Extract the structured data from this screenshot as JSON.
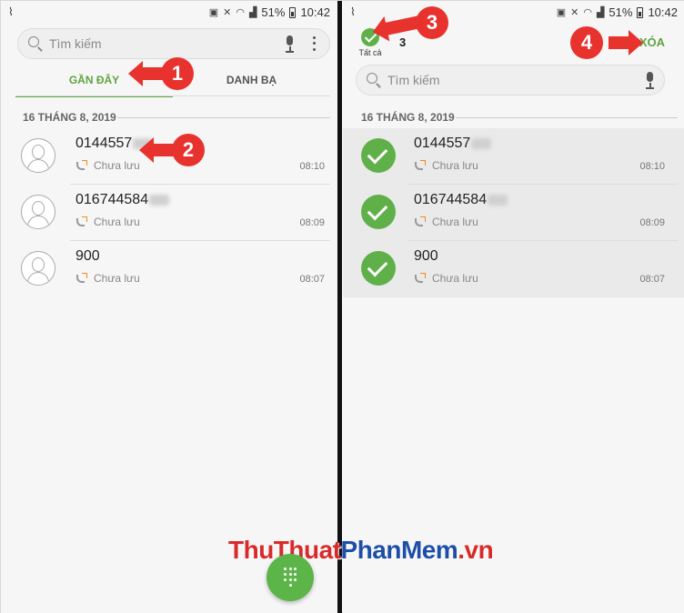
{
  "status": {
    "signal_text": "51%",
    "time": "10:42"
  },
  "left": {
    "search_placeholder": "Tìm kiếm",
    "tabs": [
      {
        "label": "GẦN ĐÂY"
      },
      {
        "label": "DANH BẠ"
      }
    ],
    "section_date": "16 THÁNG 8, 2019",
    "calls": [
      {
        "number": "0144557",
        "status": "Chưa lưu",
        "time": "08:10"
      },
      {
        "number": "016744584",
        "status": "Chưa lưu",
        "time": "08:09"
      },
      {
        "number": "900",
        "status": "Chưa lưu",
        "time": "08:07"
      }
    ]
  },
  "right": {
    "select_all_label": "Tất cả",
    "selected_count": "3",
    "delete_label": "XÓA",
    "search_placeholder": "Tìm kiếm",
    "section_date": "16 THÁNG 8, 2019",
    "calls": [
      {
        "number": "0144557",
        "status": "Chưa lưu",
        "time": "08:10"
      },
      {
        "number": "016744584",
        "status": "Chưa lưu",
        "time": "08:09"
      },
      {
        "number": "900",
        "status": "Chưa lưu",
        "time": "08:07"
      }
    ]
  },
  "badges": [
    "1",
    "2",
    "3",
    "4"
  ],
  "watermark": {
    "part1": "ThuThuat",
    "part2": "PhanMem",
    "part3": ".vn"
  },
  "colors": {
    "accent_green": "#5fa341",
    "badge_red": "#e8322d",
    "check_green": "#60b04a"
  }
}
